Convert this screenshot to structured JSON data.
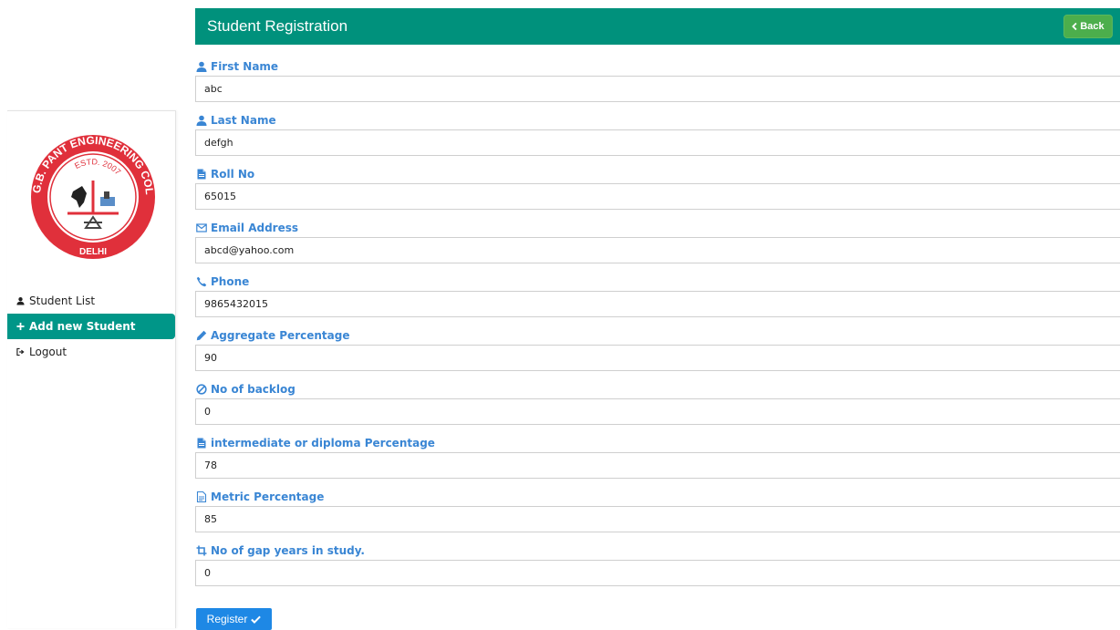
{
  "sidebar": {
    "logo_text": [
      "G.B. PANT ENGINEERING COLLEGE",
      "ESTD. 2007",
      "DELHI"
    ],
    "items": [
      {
        "label": "Student List",
        "icon": "user-icon",
        "active": false
      },
      {
        "label": "Add new Student",
        "icon": "plus-icon",
        "active": true
      },
      {
        "label": "Logout",
        "icon": "sign-out-icon",
        "active": false
      }
    ]
  },
  "header": {
    "title": "Student Registration",
    "back_label": "Back",
    "color": "#00917c"
  },
  "form": {
    "fields": [
      {
        "label": "First Name",
        "icon": "user-icon",
        "value": "abc"
      },
      {
        "label": "Last Name",
        "icon": "user-icon",
        "value": "defgh"
      },
      {
        "label": "Roll No",
        "icon": "file-icon",
        "value": "65015"
      },
      {
        "label": "Email Address",
        "icon": "envelope-icon",
        "value": "abcd@yahoo.com"
      },
      {
        "label": "Phone",
        "icon": "phone-icon",
        "value": "9865432015"
      },
      {
        "label": "Aggregate Percentage",
        "icon": "pencil-icon",
        "value": "90"
      },
      {
        "label": "No of backlog",
        "icon": "ban-icon",
        "value": "0"
      },
      {
        "label": "intermediate or diploma Percentage",
        "icon": "file-icon",
        "value": "78"
      },
      {
        "label": "Metric Percentage",
        "icon": "file-text-icon",
        "value": "85"
      },
      {
        "label": "No of gap years in study.",
        "icon": "crop-icon",
        "value": "0"
      }
    ],
    "register_label": "Register"
  },
  "colors": {
    "accent": "#009688",
    "label": "#3a86d4",
    "back_button": "#4cae4c",
    "register_button": "#1e88e5"
  }
}
